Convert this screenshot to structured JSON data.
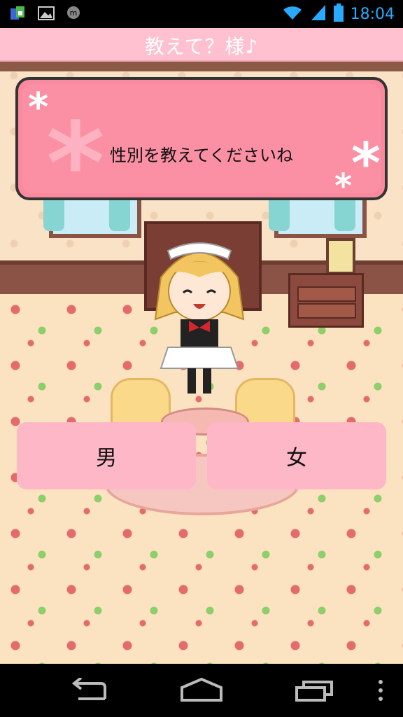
{
  "status_bar": {
    "time": "18:04",
    "icons": [
      "app-notification-icon",
      "image-icon",
      "messaging-icon",
      "wifi-icon",
      "signal-icon",
      "battery-icon"
    ]
  },
  "app": {
    "title": "教えて？様♪"
  },
  "dialog": {
    "message": "性別を教えてくださいね"
  },
  "choices": {
    "male_label": "男",
    "female_label": "女"
  },
  "colors": {
    "title_bar": "#ffc0cf",
    "speech_box": "#f9899e",
    "choice_button": "#fdb7c6",
    "clock": "#29a9ff"
  },
  "nav_bar": {
    "icons": [
      "back-icon",
      "home-icon",
      "recents-icon",
      "menu-icon"
    ]
  }
}
